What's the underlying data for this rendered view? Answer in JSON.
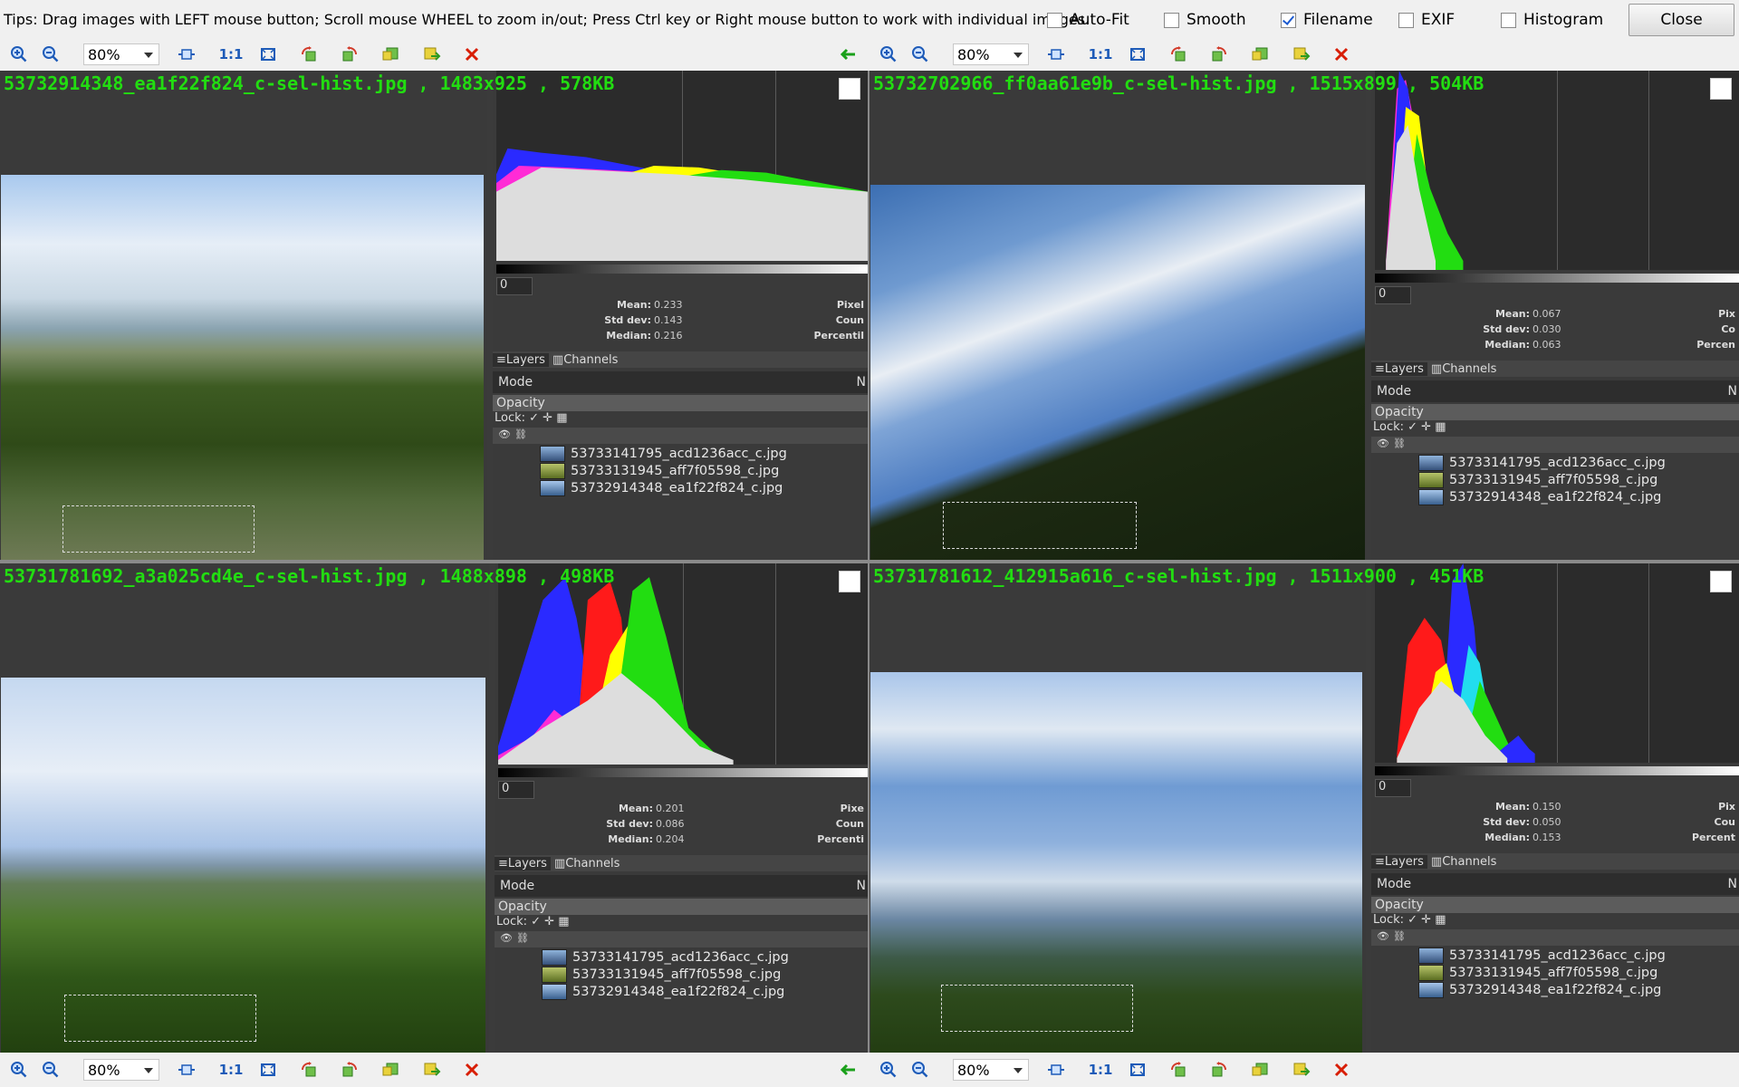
{
  "tips": "Tips: Drag images with LEFT mouse button; Scroll mouse WHEEL to zoom in/out; Press Ctrl key or Right mouse button to work with individual images.",
  "options": {
    "autofit": {
      "label": "Auto-Fit",
      "checked": false
    },
    "smooth": {
      "label": "Smooth",
      "checked": false
    },
    "filename": {
      "label": "Filename",
      "checked": true
    },
    "exif": {
      "label": "EXIF",
      "checked": false
    },
    "histogram": {
      "label": "Histogram",
      "checked": false
    }
  },
  "close_label": "Close",
  "toolbar": {
    "zoom": "80%",
    "one_to_one": "1:1"
  },
  "panes": [
    {
      "filename": "53732914348_ea1f22f824_c-sel-hist.jpg , 1483x925 , 578KB",
      "spin": "0",
      "mean_label": "Mean:",
      "mean": "0.233",
      "std_label": "Std dev:",
      "std": "0.143",
      "median_label": "Median:",
      "median": "0.216",
      "pixels": "Pixel",
      "count": "Coun",
      "percentile": "Percentil"
    },
    {
      "filename": "53732702966_ff0aa61e9b_c-sel-hist.jpg , 1515x899 , 504KB",
      "spin": "0",
      "mean_label": "Mean:",
      "mean": "0.067",
      "std_label": "Std dev:",
      "std": "0.030",
      "median_label": "Median:",
      "median": "0.063",
      "pixels": "Pix",
      "count": "Co",
      "percentile": "Percen"
    },
    {
      "filename": "53731781692_a3a025cd4e_c-sel-hist.jpg , 1488x898 , 498KB",
      "spin": "0",
      "mean_label": "Mean:",
      "mean": "0.201",
      "std_label": "Std dev:",
      "std": "0.086",
      "median_label": "Median:",
      "median": "0.204",
      "pixels": "Pixe",
      "count": "Coun",
      "percentile": "Percenti"
    },
    {
      "filename": "53731781612_412915a616_c-sel-hist.jpg , 1511x900 , 451KB",
      "spin": "0",
      "mean_label": "Mean:",
      "mean": "0.150",
      "std_label": "Std dev:",
      "std": "0.050",
      "median_label": "Median:",
      "median": "0.153",
      "pixels": "Pix",
      "count": "Cou",
      "percentile": "Percent"
    }
  ],
  "gimp": {
    "layers_tab": "Layers",
    "channels_tab": "Channels",
    "mode": "Mode",
    "mode_value_a": "N",
    "opacity": "Opacity",
    "lock": "Lock:",
    "layer_items": [
      "53733141795_acd1236acc_c.jpg",
      "53733131945_aff7f05598_c.jpg",
      "53732914348_ea1f22f824_c.jpg"
    ]
  },
  "icons": [
    "zoom-in-icon",
    "zoom-out-icon",
    "fit-width-icon",
    "one-to-one",
    "fit-screen-icon",
    "rotate-left-icon",
    "rotate-right-icon",
    "prev-image-icon",
    "next-image-icon",
    "delete-icon",
    "back-arrow-icon"
  ],
  "colors": {
    "filename_text": "#22dd11",
    "close_x": "#d81e05",
    "back_arrow": "#1aa01a"
  }
}
